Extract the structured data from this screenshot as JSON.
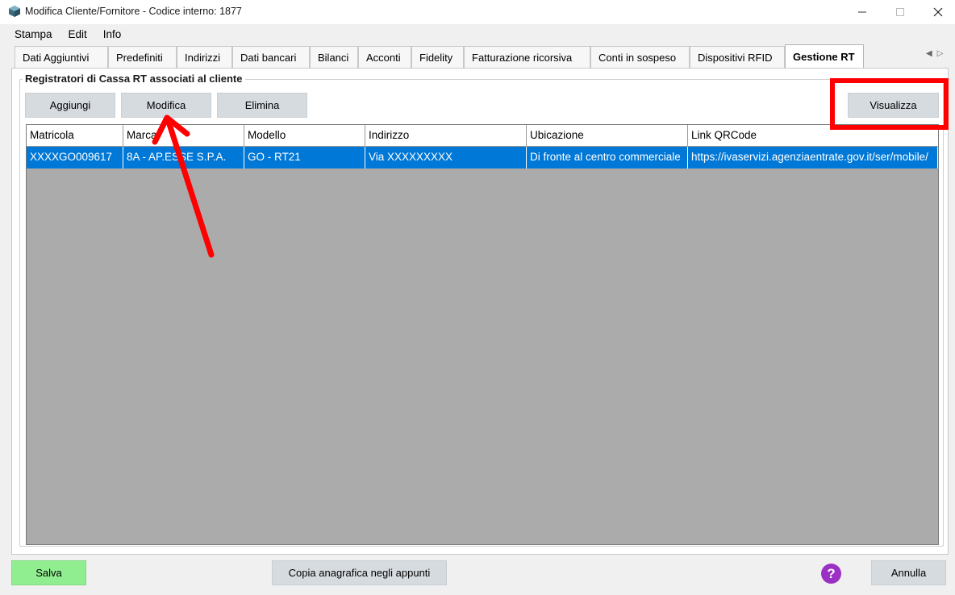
{
  "window": {
    "title": "Modifica Cliente/Fornitore - Codice interno: 1877",
    "icon": "app-icon"
  },
  "menu": [
    "Stampa",
    "Edit",
    "Info"
  ],
  "tabs": [
    "Dati Aggiuntivi",
    "Predefiniti",
    "Indirizzi",
    "Dati bancari",
    "Bilanci",
    "Acconti",
    "Fidelity",
    "Fatturazione ricorsiva",
    "Conti in sospeso",
    "Dispositivi RFID",
    "Gestione RT"
  ],
  "active_tab": "Gestione RT",
  "group": {
    "title": "Registratori di Cassa RT associati al cliente"
  },
  "toolbar": {
    "aggiungi": "Aggiungi",
    "modifica": "Modifica",
    "elimina": "Elimina",
    "visualizza": "Visualizza"
  },
  "grid": {
    "columns": [
      "Matricola",
      "Marca",
      "Modello",
      "Indirizzo",
      "Ubicazione",
      "Link QRCode"
    ],
    "rows": [
      [
        "XXXXGO009617",
        "8A - AP.ESSE S.P.A.",
        "GO - RT21",
        "Via XXXXXXXXX",
        "Di fronte al centro commerciale",
        "https://ivaservizi.agenziaentrate.gov.it/ser/mobile/"
      ]
    ]
  },
  "footer": {
    "salva": "Salva",
    "copia": "Copia anagrafica negli appunti",
    "help": "?",
    "annulla": "Annulla"
  },
  "colors": {
    "selection": "#0078d7",
    "salva": "#90ee90",
    "annotation": "#ff0000",
    "help": "#9b30c4"
  }
}
